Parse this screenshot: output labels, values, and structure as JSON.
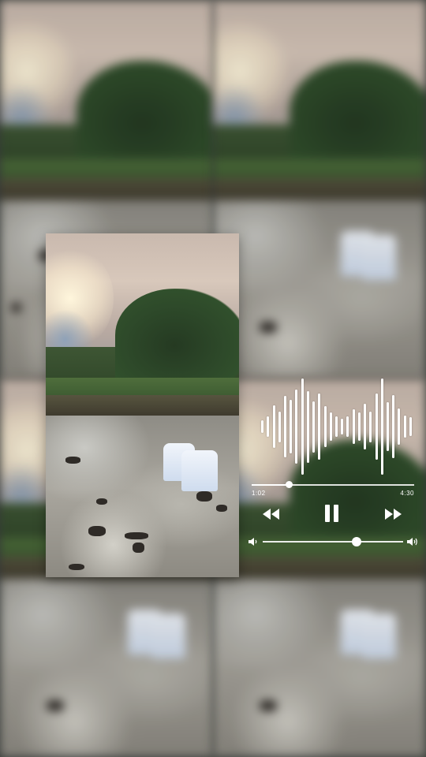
{
  "player": {
    "elapsed_time": "1:02",
    "total_time": "4:30",
    "progress_fraction": 0.23,
    "volume_fraction": 0.67,
    "state": "playing",
    "icons": {
      "previous": "rewind-icon",
      "pause": "pause-icon",
      "next": "fast-forward-icon",
      "volume_low": "volume-low-icon",
      "volume_high": "volume-high-icon"
    }
  },
  "waveform_levels": [
    0.13,
    0.2,
    0.42,
    0.3,
    0.6,
    0.52,
    0.72,
    0.94,
    0.7,
    0.5,
    0.64,
    0.4,
    0.28,
    0.2,
    0.16,
    0.2,
    0.34,
    0.28,
    0.44,
    0.3,
    0.64,
    0.94,
    0.48,
    0.62,
    0.36,
    0.22,
    0.18
  ],
  "colors": {
    "controls": "#ffffff"
  }
}
